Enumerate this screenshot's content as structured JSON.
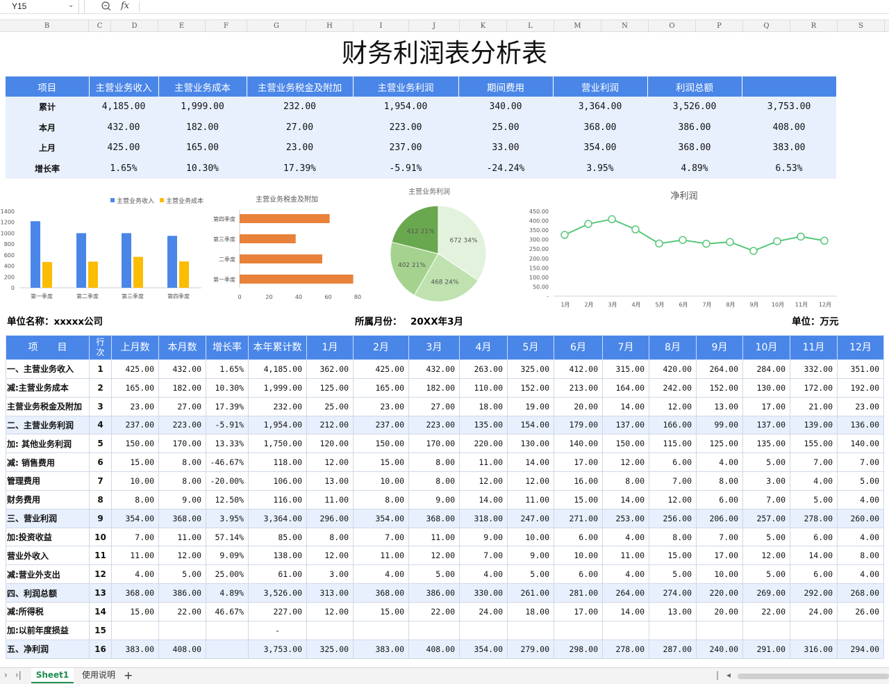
{
  "formula_bar": {
    "cell_ref": "Y15",
    "fx": "fx"
  },
  "columns": [
    "B",
    "C",
    "D",
    "E",
    "F",
    "G",
    "H",
    "I",
    "J",
    "K",
    "L",
    "M",
    "N",
    "O",
    "P",
    "Q",
    "R",
    "S"
  ],
  "title": "财务利润表分析表",
  "summary": {
    "headers": [
      "项目",
      "主营业务收入",
      "主营业务成本",
      "主营业务税金及附加",
      "主营业务利润",
      "期间费用",
      "营业利润",
      "利润总额",
      ""
    ],
    "rows": [
      [
        "累计",
        "4,185.00",
        "1,999.00",
        "232.00",
        "1,954.00",
        "340.00",
        "3,364.00",
        "3,526.00",
        "3,753.00"
      ],
      [
        "本月",
        "432.00",
        "182.00",
        "27.00",
        "223.00",
        "25.00",
        "368.00",
        "386.00",
        "408.00"
      ],
      [
        "上月",
        "425.00",
        "165.00",
        "23.00",
        "237.00",
        "33.00",
        "354.00",
        "368.00",
        "383.00"
      ],
      [
        "增长率",
        "1.65%",
        "10.30%",
        "17.39%",
        "-5.91%",
        "-24.24%",
        "3.95%",
        "4.89%",
        "6.53%"
      ]
    ]
  },
  "charts": {
    "bar": {
      "legend": [
        "主营业务收入",
        "主营业务成本"
      ],
      "yticks": [
        "1400",
        "1200",
        "1000",
        "800",
        "600",
        "400",
        "200",
        "0"
      ],
      "colors": {
        "income": "#4a86e8",
        "cost": "#fbbc04"
      }
    },
    "hbar": {
      "title": "主营业务税金及附加",
      "xticks": [
        "0",
        "20",
        "40",
        "60",
        "80"
      ],
      "color": "#e8823a"
    },
    "pie": {
      "title": "主营业务利润"
    },
    "line": {
      "title": "净利润",
      "yticks": [
        "450.00",
        "400.00",
        "350.00",
        "300.00",
        "250.00",
        "200.00",
        "150.00",
        "100.00",
        "50.00",
        "-"
      ],
      "color": "#57c77a"
    }
  },
  "chart_data": [
    {
      "type": "bar",
      "categories": [
        "第一季度",
        "第二季度",
        "第三季度",
        "第四季度"
      ],
      "series": [
        {
          "name": "主营业务收入",
          "values": [
            1219,
            1000,
            1000,
            951
          ]
        },
        {
          "name": "主营业务成本",
          "values": [
            472,
            479,
            566,
            483
          ]
        }
      ],
      "ylim": [
        0,
        1400
      ]
    },
    {
      "type": "bar",
      "title": "主营业务税金及附加",
      "categories": [
        "第四季度",
        "第三季度",
        "二季度",
        "第一季度"
      ],
      "values": [
        61,
        38,
        56,
        77
      ],
      "xlim": [
        0,
        80
      ]
    },
    {
      "type": "pie",
      "title": "主营业务利润",
      "labels": [
        "672  34%",
        "468  24%",
        "402  21%",
        "412  21%"
      ],
      "values": [
        672,
        468,
        402,
        412
      ],
      "colors": [
        "#e3f2dc",
        "#bfe2b0",
        "#a5d38f",
        "#6aa84f"
      ]
    },
    {
      "type": "line",
      "title": "净利润",
      "categories": [
        "1月",
        "2月",
        "3月",
        "4月",
        "5月",
        "6月",
        "7月",
        "8月",
        "9月",
        "10月",
        "11月",
        "12月"
      ],
      "values": [
        325,
        383,
        408,
        354,
        279,
        298,
        278,
        287,
        240,
        291,
        316,
        294
      ],
      "ylim": [
        0,
        450
      ]
    }
  ],
  "info": {
    "company": "单位名称：xxxxx公司",
    "month_label": "所属月份：",
    "month_value": "20XX年3月",
    "unit": "单位：万元"
  },
  "detail": {
    "headers": [
      "项　　目",
      "行次",
      "上月数",
      "本月数",
      "增长率",
      "本年累计数",
      "1月",
      "2月",
      "3月",
      "4月",
      "5月",
      "6月",
      "7月",
      "8月",
      "9月",
      "10月",
      "11月",
      "12月"
    ],
    "rows": [
      [
        "一、主营业务收入",
        "1",
        "425.00",
        "432.00",
        "1.65%",
        "4,185.00",
        "362.00",
        "425.00",
        "432.00",
        "263.00",
        "325.00",
        "412.00",
        "315.00",
        "420.00",
        "264.00",
        "284.00",
        "332.00",
        "351.00"
      ],
      [
        "减:主营业务成本",
        "2",
        "165.00",
        "182.00",
        "10.30%",
        "1,999.00",
        "125.00",
        "165.00",
        "182.00",
        "110.00",
        "152.00",
        "213.00",
        "164.00",
        "242.00",
        "152.00",
        "130.00",
        "172.00",
        "192.00"
      ],
      [
        "主营业务税金及附加",
        "3",
        "23.00",
        "27.00",
        "17.39%",
        "232.00",
        "25.00",
        "23.00",
        "27.00",
        "18.00",
        "19.00",
        "20.00",
        "14.00",
        "12.00",
        "13.00",
        "17.00",
        "21.00",
        "23.00"
      ],
      [
        "二、主营业务利润",
        "4",
        "237.00",
        "223.00",
        "-5.91%",
        "1,954.00",
        "212.00",
        "237.00",
        "223.00",
        "135.00",
        "154.00",
        "179.00",
        "137.00",
        "166.00",
        "99.00",
        "137.00",
        "139.00",
        "136.00"
      ],
      [
        "加: 其他业务利润",
        "5",
        "150.00",
        "170.00",
        "13.33%",
        "1,750.00",
        "120.00",
        "150.00",
        "170.00",
        "220.00",
        "130.00",
        "140.00",
        "150.00",
        "115.00",
        "125.00",
        "135.00",
        "155.00",
        "140.00"
      ],
      [
        "减: 销售费用",
        "6",
        "15.00",
        "8.00",
        "-46.67%",
        "118.00",
        "12.00",
        "15.00",
        "8.00",
        "11.00",
        "14.00",
        "17.00",
        "12.00",
        "6.00",
        "4.00",
        "5.00",
        "7.00",
        "7.00"
      ],
      [
        "管理费用",
        "7",
        "10.00",
        "8.00",
        "-20.00%",
        "106.00",
        "13.00",
        "10.00",
        "8.00",
        "12.00",
        "12.00",
        "16.00",
        "8.00",
        "7.00",
        "8.00",
        "3.00",
        "4.00",
        "5.00"
      ],
      [
        "财务费用",
        "8",
        "8.00",
        "9.00",
        "12.50%",
        "116.00",
        "11.00",
        "8.00",
        "9.00",
        "14.00",
        "11.00",
        "15.00",
        "14.00",
        "12.00",
        "6.00",
        "7.00",
        "5.00",
        "4.00"
      ],
      [
        "三、营业利润",
        "9",
        "354.00",
        "368.00",
        "3.95%",
        "3,364.00",
        "296.00",
        "354.00",
        "368.00",
        "318.00",
        "247.00",
        "271.00",
        "253.00",
        "256.00",
        "206.00",
        "257.00",
        "278.00",
        "260.00"
      ],
      [
        "加:投资收益",
        "10",
        "7.00",
        "11.00",
        "57.14%",
        "85.00",
        "8.00",
        "7.00",
        "11.00",
        "9.00",
        "10.00",
        "6.00",
        "4.00",
        "8.00",
        "7.00",
        "5.00",
        "6.00",
        "4.00"
      ],
      [
        "营业外收入",
        "11",
        "11.00",
        "12.00",
        "9.09%",
        "138.00",
        "12.00",
        "11.00",
        "12.00",
        "7.00",
        "9.00",
        "10.00",
        "11.00",
        "15.00",
        "17.00",
        "12.00",
        "14.00",
        "8.00"
      ],
      [
        "减:营业外支出",
        "12",
        "4.00",
        "5.00",
        "25.00%",
        "61.00",
        "3.00",
        "4.00",
        "5.00",
        "4.00",
        "5.00",
        "6.00",
        "4.00",
        "5.00",
        "10.00",
        "5.00",
        "6.00",
        "4.00"
      ],
      [
        "四、利润总额",
        "13",
        "368.00",
        "386.00",
        "4.89%",
        "3,526.00",
        "313.00",
        "368.00",
        "386.00",
        "330.00",
        "261.00",
        "281.00",
        "264.00",
        "274.00",
        "220.00",
        "269.00",
        "292.00",
        "268.00"
      ],
      [
        "减:所得税",
        "14",
        "15.00",
        "22.00",
        "46.67%",
        "227.00",
        "12.00",
        "15.00",
        "22.00",
        "24.00",
        "18.00",
        "17.00",
        "14.00",
        "13.00",
        "20.00",
        "22.00",
        "24.00",
        "26.00"
      ],
      [
        "加:以前年度损益",
        "15",
        "",
        "",
        "",
        "-",
        "",
        "",
        "",
        "",
        "",
        "",
        "",
        "",
        "",
        "",
        "",
        ""
      ],
      [
        "五、净利润",
        "16",
        "383.00",
        "408.00",
        "",
        "3,753.00",
        "325.00",
        "383.00",
        "408.00",
        "354.00",
        "279.00",
        "298.00",
        "278.00",
        "287.00",
        "240.00",
        "291.00",
        "316.00",
        "294.00"
      ]
    ],
    "highlight_rows": [
      3,
      8,
      12,
      15
    ]
  },
  "tabs": {
    "sheet1": "Sheet1",
    "usage": "使用说明",
    "add": "+"
  }
}
